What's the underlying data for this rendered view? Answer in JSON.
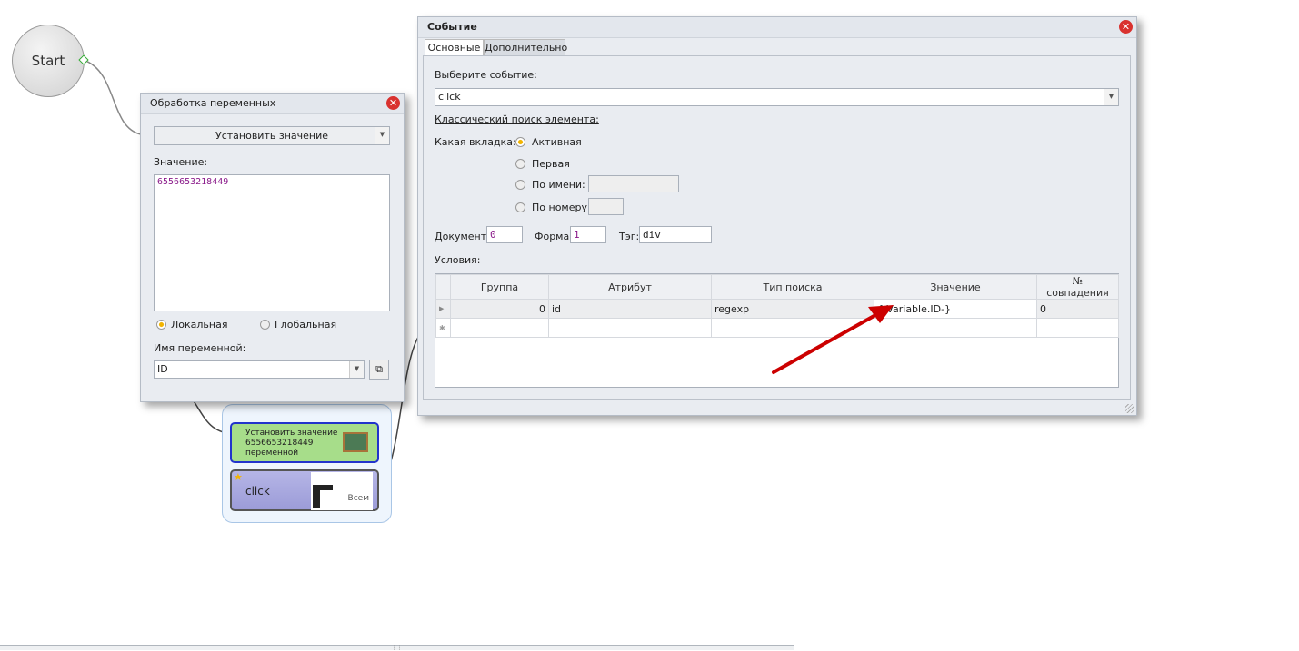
{
  "canvas": {
    "start_label": "Start"
  },
  "var_window": {
    "title": "Обработка переменных",
    "action": "Установить значение",
    "value_label": "Значение:",
    "value": "6556653218449",
    "scope_local": "Локальная",
    "scope_global": "Глобальная",
    "scope_selected": "local",
    "varname_label": "Имя переменной:",
    "varname": "ID"
  },
  "nodes": {
    "set_value": {
      "line1": "Установить значение",
      "line2": "6556653218449",
      "line3": "переменной"
    },
    "click": {
      "label": "click",
      "thumb_text": "Всем"
    }
  },
  "event_window": {
    "title": "Событие",
    "tabs": [
      "Основные",
      "Дополнительно"
    ],
    "choose_label": "Выберите событие:",
    "event": "click",
    "classic_label": "Классический поиск элемента:",
    "which_tab_label": "Какая вкладка:",
    "tab_opts": [
      "Активная",
      "Первая",
      "По имени:",
      "По номеру:"
    ],
    "doc_label": "Документ:",
    "doc": "0",
    "form_label": "Форма:",
    "form": "1",
    "tag_label": "Тэг:",
    "tag": "div",
    "conditions_label": "Условия:",
    "columns": [
      "Группа",
      "Атрибут",
      "Тип поиска",
      "Значение",
      "№ совпадения"
    ],
    "rows": [
      [
        "0",
        "id",
        "regexp",
        "{-Variable.ID-}",
        "0"
      ]
    ]
  }
}
